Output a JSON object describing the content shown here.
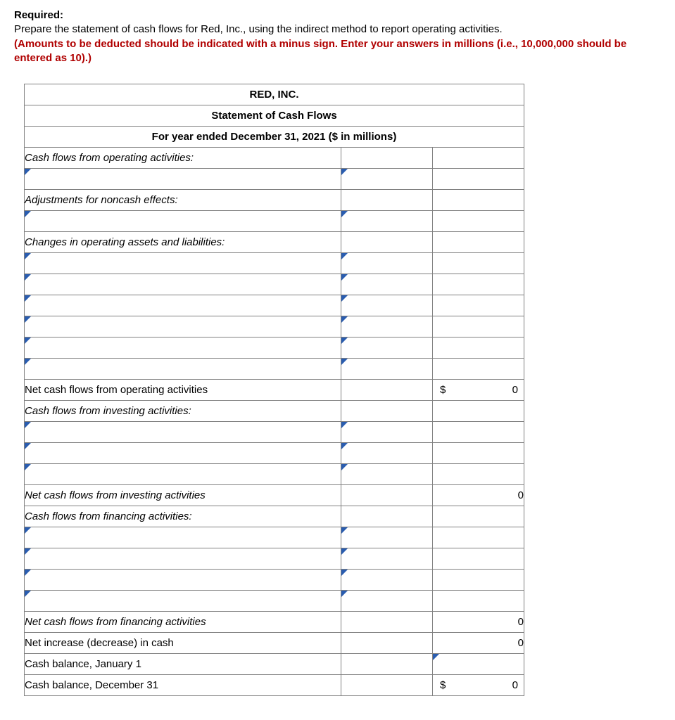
{
  "instructions": {
    "required_label": "Required:",
    "prepare_text": "Prepare the statement of cash flows for Red, Inc., using the indirect method to report operating activities.",
    "warning_text": "(Amounts to be deducted should be indicated with a minus sign. Enter your answers in millions (i.e., 10,000,000 should be entered as 10).)"
  },
  "headers": {
    "company": "RED, INC.",
    "title": "Statement of Cash Flows",
    "period": "For year ended December 31, 2021 ($ in millions)"
  },
  "sections": {
    "operating_header": "Cash flows from operating activities:",
    "adjustments_header": "Adjustments for noncash effects:",
    "changes_header": "Changes in operating assets and liabilities:",
    "net_operating": "Net cash flows from operating activities",
    "investing_header": "Cash flows from investing activities:",
    "net_investing": "Net cash flows from investing activities",
    "financing_header": "Cash flows from financing activities:",
    "net_financing": "Net cash flows from financing activities",
    "net_change": "Net increase (decrease) in cash",
    "balance_jan": "Cash balance, January 1",
    "balance_dec": "Cash balance, December 31"
  },
  "currency_symbol": "$",
  "values": {
    "net_operating": "0",
    "net_investing": "0",
    "net_financing": "0",
    "net_change": "0",
    "balance_dec": "0"
  }
}
